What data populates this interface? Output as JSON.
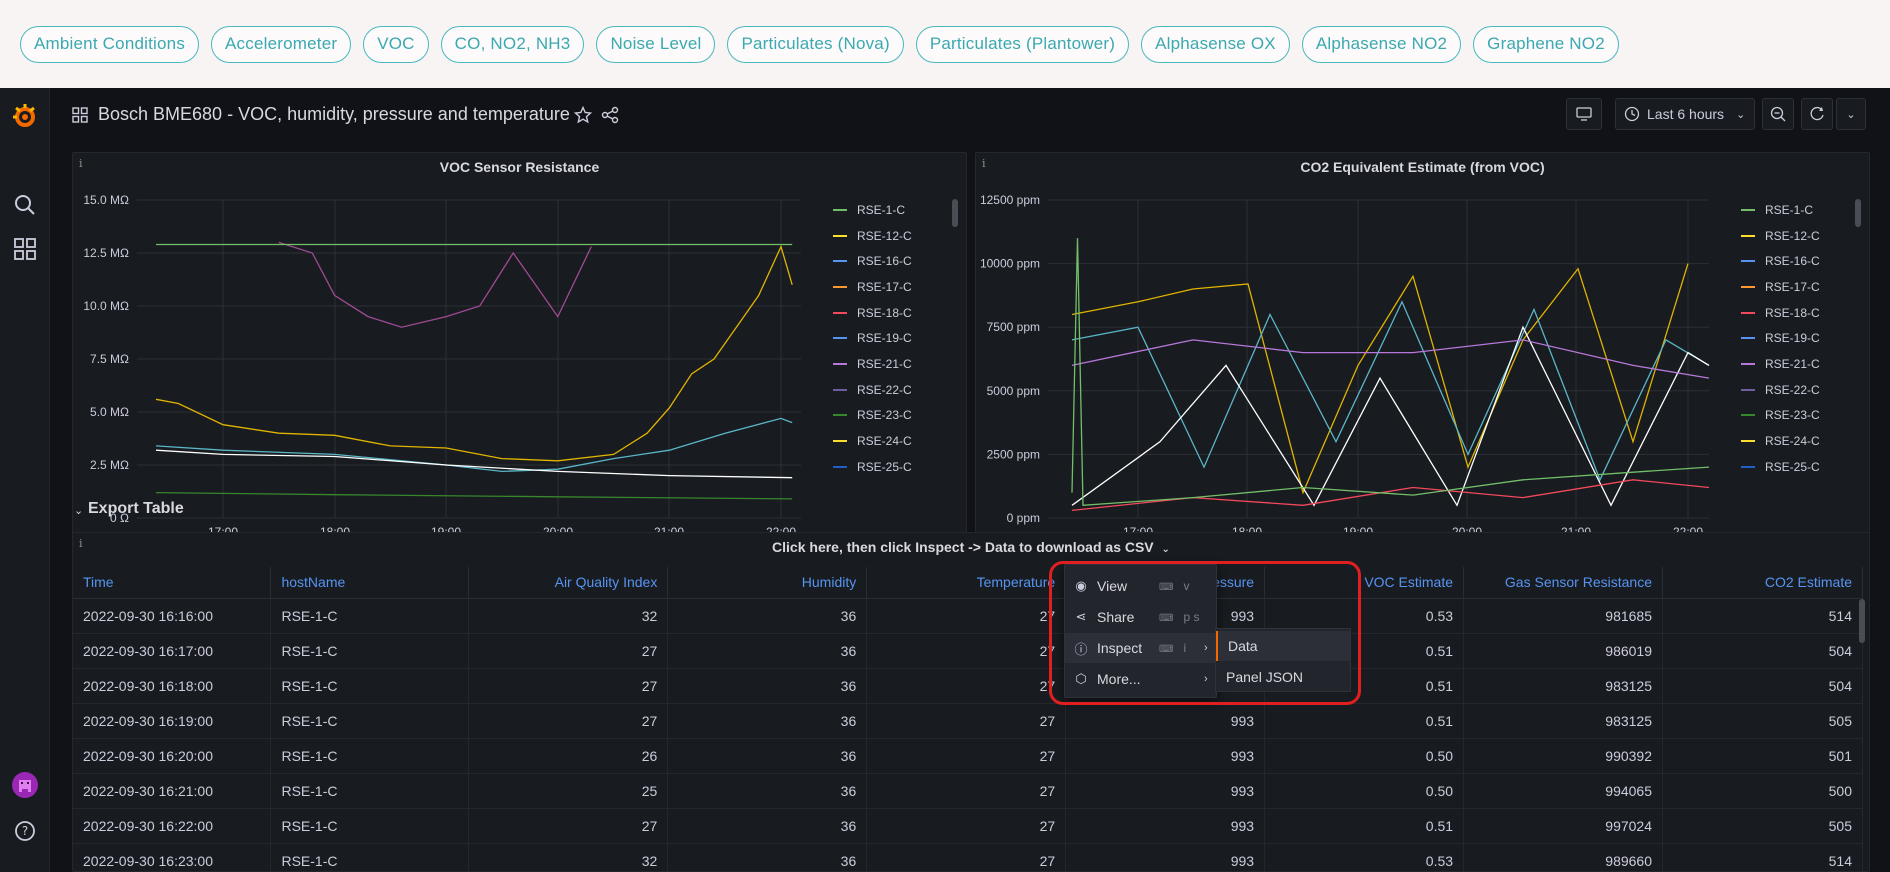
{
  "top_nav": {
    "pills": [
      "Ambient Conditions",
      "Accelerometer",
      "VOC",
      "CO, NO2, NH3",
      "Noise Level",
      "Particulates (Nova)",
      "Particulates (Plantower)",
      "Alphasense OX",
      "Alphasense NO2",
      "Graphene NO2"
    ]
  },
  "sidebar": {
    "icons": [
      "grafana-logo-icon",
      "search-icon",
      "dashboards-icon",
      "user-avatar-icon",
      "help-icon"
    ]
  },
  "toolbar": {
    "title": "Bosch BME680 - VOC, humidity, pressure and temperature",
    "time_range": "Last 6 hours"
  },
  "colors": {
    "accent_blue": "#5794f2",
    "highlight_red": "#e02020",
    "pill_teal": "#49b8bf"
  },
  "chart_data": [
    {
      "type": "line",
      "title": "VOC Sensor Resistance",
      "y_ticks": [
        "15.0 MΩ",
        "12.5 MΩ",
        "10.0 MΩ",
        "7.5 MΩ",
        "5.0 MΩ",
        "2.5 MΩ",
        "0 Ω"
      ],
      "x_ticks": [
        "17:00",
        "18:00",
        "19:00",
        "20:00",
        "21:00",
        "22:00"
      ],
      "ylim": [
        0,
        15
      ],
      "yunit": "MΩ",
      "legend": [
        "RSE-1-C",
        "RSE-12-C",
        "RSE-16-C",
        "RSE-17-C",
        "RSE-18-C",
        "RSE-19-C",
        "RSE-21-C",
        "RSE-22-C",
        "RSE-23-C",
        "RSE-24-C",
        "RSE-25-C"
      ],
      "legend_colors": [
        "#73bf69",
        "#fade2a",
        "#5794f2",
        "#ff9830",
        "#f2495c",
        "#5794f2",
        "#b877d9",
        "#705da0",
        "#37872d",
        "#fade2a",
        "#1f60c4"
      ],
      "series": [
        {
          "name": "RSE-12-C",
          "color": "#e0b400",
          "x": [
            16.4,
            16.6,
            17.0,
            17.5,
            18.0,
            18.5,
            19.0,
            19.5,
            20.0,
            20.5,
            20.8,
            21.0,
            21.2,
            21.4,
            21.6,
            21.8,
            22.0,
            22.1
          ],
          "values": [
            5.6,
            5.4,
            4.4,
            4.0,
            3.9,
            3.4,
            3.3,
            2.8,
            2.7,
            3.0,
            4.0,
            5.2,
            6.8,
            7.5,
            9.0,
            10.5,
            12.8,
            11.0
          ]
        },
        {
          "name": "RSE-21-C",
          "color": "#a04a94",
          "x": [
            17.5,
            17.8,
            18.0,
            18.3,
            18.6,
            19.0,
            19.3,
            19.6,
            19.8,
            20.0,
            20.3
          ],
          "values": [
            13.0,
            12.5,
            10.5,
            9.5,
            9.0,
            9.5,
            10.0,
            12.5,
            11.0,
            9.5,
            12.8
          ]
        },
        {
          "name": "RSE-1-C",
          "color": "#73bf69",
          "x": [
            16.4,
            22.1
          ],
          "values": [
            12.9,
            12.9
          ]
        },
        {
          "name": "RSE-16-C",
          "color": "#5bb6c9",
          "x": [
            16.4,
            17.0,
            18.0,
            19.0,
            19.5,
            20.0,
            20.5,
            21.0,
            21.5,
            22.0,
            22.1
          ],
          "values": [
            3.4,
            3.2,
            3.0,
            2.5,
            2.2,
            2.3,
            2.8,
            3.2,
            4.0,
            4.7,
            4.5
          ]
        },
        {
          "name": "RSE-17-C",
          "color": "#ffffff",
          "x": [
            16.4,
            17.0,
            18.0,
            19.0,
            20.0,
            21.0,
            22.1
          ],
          "values": [
            3.2,
            3.0,
            2.9,
            2.5,
            2.2,
            2.0,
            1.9
          ]
        },
        {
          "name": "RSE-23-C",
          "color": "#37872d",
          "x": [
            16.4,
            18.0,
            20.0,
            22.1
          ],
          "values": [
            1.2,
            1.1,
            1.0,
            0.9
          ]
        }
      ]
    },
    {
      "type": "line",
      "title": "CO2 Equivalent Estimate (from VOC)",
      "y_ticks": [
        "12500 ppm",
        "10000 ppm",
        "7500 ppm",
        "5000 ppm",
        "2500 ppm",
        "0 ppm"
      ],
      "x_ticks": [
        "17:00",
        "18:00",
        "19:00",
        "20:00",
        "21:00",
        "22:00"
      ],
      "ylim": [
        0,
        12500
      ],
      "yunit": "ppm",
      "legend": [
        "RSE-1-C",
        "RSE-12-C",
        "RSE-16-C",
        "RSE-17-C",
        "RSE-18-C",
        "RSE-19-C",
        "RSE-21-C",
        "RSE-22-C",
        "RSE-23-C",
        "RSE-24-C",
        "RSE-25-C"
      ],
      "legend_colors": [
        "#73bf69",
        "#fade2a",
        "#5794f2",
        "#ff9830",
        "#f2495c",
        "#5794f2",
        "#b877d9",
        "#705da0",
        "#37872d",
        "#fade2a",
        "#1f60c4"
      ],
      "series": [
        {
          "name": "RSE-12-C",
          "color": "#e0b400",
          "x": [
            16.4,
            17.0,
            17.5,
            18.0,
            18.5,
            19.0,
            19.5,
            20.0,
            20.5,
            21.0,
            21.5,
            22.0
          ],
          "values": [
            8000,
            8500,
            9000,
            9200,
            1000,
            6000,
            9500,
            2000,
            7000,
            9800,
            3000,
            10000
          ]
        },
        {
          "name": "RSE-16-C",
          "color": "#5bb6c9",
          "x": [
            16.4,
            17.0,
            17.6,
            18.2,
            18.8,
            19.4,
            20.0,
            20.6,
            21.2,
            21.8,
            22.2
          ],
          "values": [
            7000,
            7500,
            2000,
            8000,
            3000,
            8500,
            2500,
            8200,
            1500,
            7000,
            6000
          ]
        },
        {
          "name": "RSE-17-C",
          "color": "#ffffff",
          "x": [
            16.4,
            17.2,
            17.8,
            18.6,
            19.2,
            19.9,
            20.5,
            21.3,
            22.0,
            22.2
          ],
          "values": [
            500,
            3000,
            6000,
            500,
            5500,
            500,
            7500,
            500,
            6500,
            6000
          ]
        },
        {
          "name": "RSE-21-C",
          "color": "#b877d9",
          "x": [
            16.4,
            17.5,
            18.5,
            19.5,
            20.5,
            21.5,
            22.2
          ],
          "values": [
            6000,
            7000,
            6500,
            6500,
            7000,
            6000,
            5500
          ]
        },
        {
          "name": "RSE-18-C",
          "color": "#f2495c",
          "x": [
            16.4,
            17.5,
            18.5,
            19.5,
            20.5,
            21.5,
            22.2
          ],
          "values": [
            300,
            800,
            500,
            1200,
            800,
            1500,
            1200
          ]
        },
        {
          "name": "RSE-1-C",
          "color": "#73bf69",
          "x": [
            16.4,
            16.45,
            16.5,
            17.5,
            18.5,
            19.5,
            20.5,
            21.5,
            22.2
          ],
          "values": [
            1000,
            11000,
            500,
            800,
            1200,
            900,
            1500,
            1800,
            2000
          ]
        }
      ]
    }
  ],
  "export_table": {
    "section_label": "Export Table",
    "panel_title": "Click here, then click Inspect -> Data to download as CSV",
    "columns": [
      "Time",
      "hostName",
      "Air Quality Index",
      "Humidity",
      "Temperature",
      "Pressure",
      "VOC Estimate",
      "Gas Sensor Resistance",
      "CO2 Estimate"
    ],
    "rows": [
      [
        "2022-09-30 16:16:00",
        "RSE-1-C",
        "32",
        "36",
        "27",
        "993",
        "0.53",
        "981685",
        "514"
      ],
      [
        "2022-09-30 16:17:00",
        "RSE-1-C",
        "27",
        "36",
        "27",
        "993",
        "0.51",
        "986019",
        "504"
      ],
      [
        "2022-09-30 16:18:00",
        "RSE-1-C",
        "27",
        "36",
        "27",
        "993",
        "0.51",
        "983125",
        "504"
      ],
      [
        "2022-09-30 16:19:00",
        "RSE-1-C",
        "27",
        "36",
        "27",
        "993",
        "0.51",
        "983125",
        "505"
      ],
      [
        "2022-09-30 16:20:00",
        "RSE-1-C",
        "26",
        "36",
        "27",
        "993",
        "0.50",
        "990392",
        "501"
      ],
      [
        "2022-09-30 16:21:00",
        "RSE-1-C",
        "25",
        "36",
        "27",
        "993",
        "0.50",
        "994065",
        "500"
      ],
      [
        "2022-09-30 16:22:00",
        "RSE-1-C",
        "27",
        "36",
        "27",
        "993",
        "0.51",
        "997024",
        "505"
      ],
      [
        "2022-09-30 16:23:00",
        "RSE-1-C",
        "32",
        "36",
        "27",
        "993",
        "0.53",
        "989660",
        "514"
      ]
    ]
  },
  "context_menu": {
    "items": [
      {
        "label": "View",
        "shortcut": "v",
        "icon": "eye-icon"
      },
      {
        "label": "Share",
        "shortcut": "p s",
        "icon": "share-icon"
      },
      {
        "label": "Inspect",
        "shortcut": "i",
        "icon": "info-icon"
      },
      {
        "label": "More...",
        "shortcut": "",
        "icon": "cube-icon"
      }
    ],
    "submenu": [
      "Data",
      "Panel JSON"
    ]
  }
}
